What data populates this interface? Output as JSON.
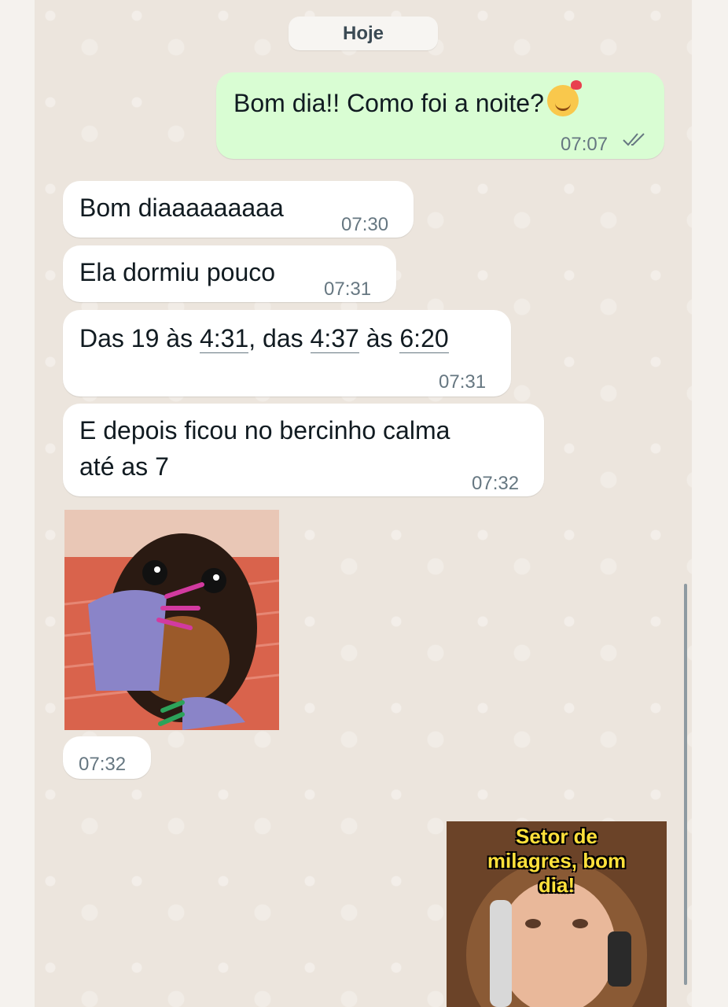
{
  "date_divider": "Hoje",
  "messages": [
    {
      "direction": "outgoing",
      "text": "Bom dia!! Como foi a noite?",
      "emoji": "smiling-face-with-hearts",
      "time": "07:07",
      "status": "read"
    },
    {
      "direction": "incoming",
      "text": "Bom diaaaaaaaaa",
      "time": "07:30"
    },
    {
      "direction": "incoming",
      "text": "Ela dormiu pouco",
      "time": "07:31"
    },
    {
      "direction": "incoming",
      "segments": [
        "Das 19 às ",
        "4:31",
        ", das ",
        "4:37",
        " às ",
        "6:20"
      ],
      "time": "07:31"
    },
    {
      "direction": "incoming",
      "lines": [
        "E depois ficou no bercinho calma",
        "até as 7"
      ],
      "time": "07:32"
    },
    {
      "direction": "incoming",
      "type": "sticker",
      "description": "dog-with-purple-hand-sticker",
      "time": "07:32"
    },
    {
      "direction": "outgoing",
      "type": "sticker",
      "meme_lines": [
        "Setor de",
        "milagres, bom",
        "dia!"
      ]
    }
  ],
  "colors": {
    "outgoing_bubble": "#d9fdd3",
    "incoming_bubble": "#ffffff",
    "chat_background": "#ece5dd",
    "read_check": "#667781",
    "meme_text": "#ffe13b"
  }
}
